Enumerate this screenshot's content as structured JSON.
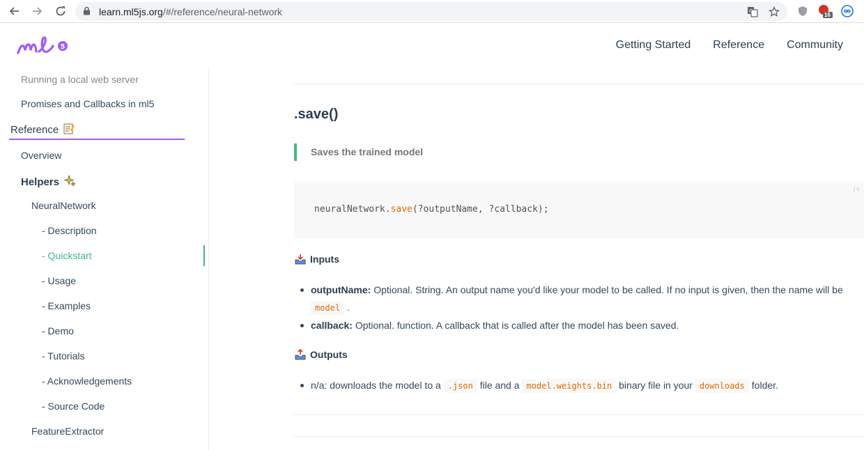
{
  "browser": {
    "url_host": "learn.ml5js.org",
    "url_path": "/#/reference/neural-network",
    "badge_count": "16"
  },
  "header": {
    "logo_text": "ml5",
    "nav": [
      "Getting Started",
      "Reference",
      "Community"
    ]
  },
  "sidebar": {
    "items": [
      "Running a local web server",
      "Promises and Callbacks in ml5",
      "Reference",
      "Overview",
      "Helpers",
      "NeuralNetwork",
      "- Description",
      "- Quickstart",
      "- Usage",
      "- Examples",
      "- Demo",
      "- Tutorials",
      "- Acknowledgements",
      "- Source Code",
      "FeatureExtractor"
    ]
  },
  "main": {
    "heading": ".save()",
    "quote": "Saves the trained model",
    "code_lang": "js",
    "code_prefix": "neuralNetwork.",
    "code_fn": "save",
    "code_suffix": "(?outputName, ?callback);",
    "inputs_heading": "Inputs",
    "input1_name": "outputName:",
    "input1_text": " Optional. String. An output name you'd like your model to be called. If no input is given, then the name will be",
    "input1_code": "model",
    "input1_end": " .",
    "input2_name": "callback:",
    "input2_text": " Optional. function. A callback that is called after the model has been saved.",
    "outputs_heading": "Outputs",
    "output1_pre": "n/a: downloads the model to a ",
    "output1_code1": ".json",
    "output1_mid1": " file and a ",
    "output1_code2": "model.weights.bin",
    "output1_mid2": " binary file in your ",
    "output1_code3": "downloads",
    "output1_end": " folder."
  },
  "colors": {
    "accent_green": "#42b983",
    "accent_purple": "#a259ff",
    "code_orange": "#e96900"
  }
}
